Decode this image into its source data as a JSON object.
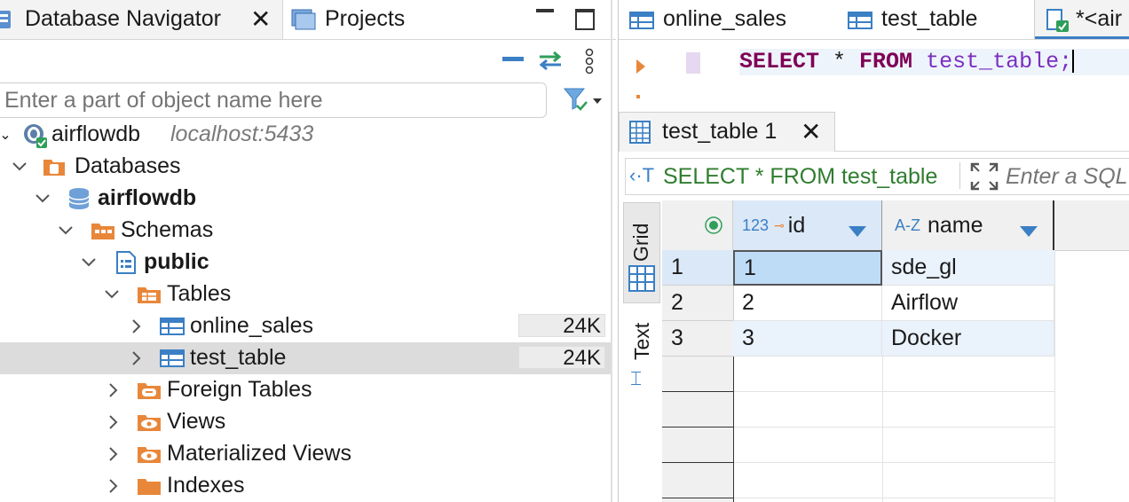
{
  "nav_panel": {
    "tabs": [
      {
        "label": "Database Navigator",
        "icon": "database-navigator-icon"
      },
      {
        "label": "Projects",
        "icon": "projects-icon"
      }
    ],
    "filter_placeholder": "Enter a part of object name here",
    "tree": {
      "connection": {
        "name": "airflowdb",
        "host": "localhost:5433"
      },
      "databases_label": "Databases",
      "database_name": "airflowdb",
      "schemas_label": "Schemas",
      "schema_name": "public",
      "tables_label": "Tables",
      "tables": [
        {
          "name": "online_sales",
          "size": "24K"
        },
        {
          "name": "test_table",
          "size": "24K"
        }
      ],
      "foreign_tables_label": "Foreign Tables",
      "views_label": "Views",
      "materialized_views_label": "Materialized Views",
      "indexes_label": "Indexes"
    }
  },
  "editor": {
    "tabs": [
      {
        "label": "online_sales"
      },
      {
        "label": "test_table"
      },
      {
        "label": "*<air"
      }
    ],
    "sql": {
      "kw1": "SELECT",
      "star": " * ",
      "kw2": "FROM",
      "table": "test_table",
      "semi": ";"
    }
  },
  "results": {
    "tab_label": "test_table 1",
    "query_text": "SELECT * FROM test_table",
    "filter_placeholder": "Enter a SQL",
    "side_tabs": {
      "grid": "Grid",
      "text": "Text"
    },
    "columns": [
      {
        "type_prefix": "123",
        "name": "id"
      },
      {
        "type_prefix": "A-Z",
        "name": "name"
      }
    ],
    "rows": [
      {
        "num": "1",
        "id": "1",
        "name": "sde_gl"
      },
      {
        "num": "2",
        "id": "2",
        "name": "Airflow"
      },
      {
        "num": "3",
        "id": "3",
        "name": "Docker"
      }
    ]
  },
  "colors": {
    "keyword": "#7f0055",
    "identifier": "#7b2fbf",
    "accent_blue": "#3b7fc4",
    "folder_orange": "#e8873a",
    "selection": "#dcdcdc",
    "cell_selected": "#bfdcf7",
    "query_green": "#2f7d2f"
  }
}
